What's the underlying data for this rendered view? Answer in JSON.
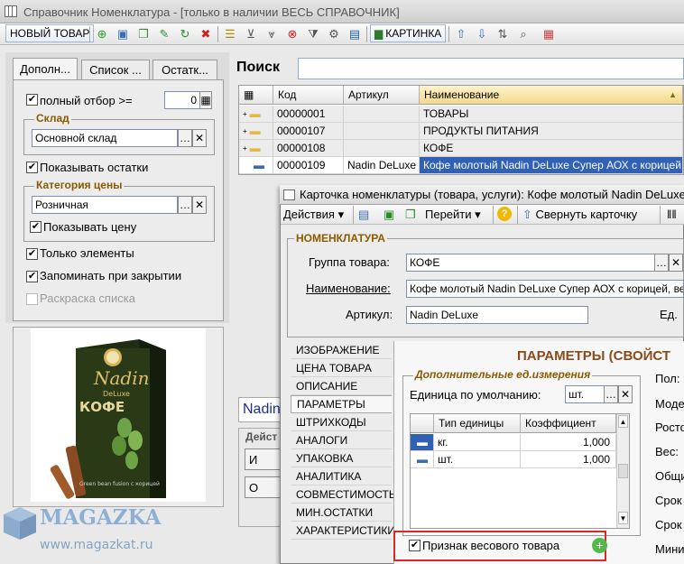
{
  "window": {
    "title": "Справочник Номенклатура - [только в наличии ВЕСЬ СПРАВОЧНИК]"
  },
  "toolbar": {
    "new_item_label": "НОВЫЙ ТОВАР",
    "picture_label": "КАРТИНКА"
  },
  "left_tabs": [
    "Дополн...",
    "Список ...",
    "Остатк..."
  ],
  "filters": {
    "full_select_label": "полный отбор >=",
    "full_select_value": "0",
    "warehouse_group": "Склад",
    "warehouse_value": "Основной склад",
    "show_stock_label": "Показывать остатки",
    "price_group": "Категория цены",
    "price_value": "Розничная",
    "show_price_label": "Показывать цену",
    "only_elements_label": "Только элементы",
    "remember_label": "Запоминать при закрытии",
    "coloring_label": "Раскраска списка"
  },
  "product_image": {
    "brand": "Nadin",
    "sub": "DeLuxe",
    "name": "КОФЕ",
    "caption": "Green bean fusion с корицей"
  },
  "search": {
    "label": "Поиск",
    "value": ""
  },
  "grid": {
    "columns": [
      "Код",
      "Артикул",
      "Наименование"
    ],
    "rows": [
      {
        "code": "00000001",
        "article": "",
        "name": "ТОВАРЫ"
      },
      {
        "code": "00000107",
        "article": "",
        "name": "ПРОДУКТЫ ПИТАНИЯ"
      },
      {
        "code": "00000108",
        "article": "",
        "name": "КОФЕ"
      },
      {
        "code": "00000109",
        "article": "Nadin DeLuxe",
        "name": "Кофе молотый Nadin DeLuxe Супер АОХ с корицей, в..."
      }
    ]
  },
  "under": {
    "strip_text": "Nadin",
    "group_label": "Дейст",
    "btn1": "И",
    "btn2": "О"
  },
  "card": {
    "title": "Карточка номенклатуры (товара, услуги): Кофе молотый Nadin DeLuxe",
    "actions_label": "Действия",
    "goto_label": "Перейти",
    "collapse_label": "Свернуть карточку",
    "section_title": "НОМЕНКЛАТУРА",
    "group_label": "Группа товара:",
    "group_value": "КОФЕ",
    "name_label": "Наименование:",
    "name_value": "Кофе молотый Nadin DeLuxe Супер АОХ с корицей, весовой",
    "article_label": "Артикул:",
    "article_value": "Nadin DeLuxe",
    "ed_label": "Ед.",
    "side_tabs": [
      "ИЗОБРАЖЕНИЕ",
      "ЦЕНА ТОВАРА",
      "ОПИСАНИЕ",
      "ПАРАМЕТРЫ",
      "ШТРИХКОДЫ",
      "АНАЛОГИ",
      "УПАКОВКА",
      "АНАЛИТИКА",
      "СОВМЕСТИМОСТЬ",
      "МИН.ОСТАТКИ",
      "ХАРАКТЕРИСТИКИ"
    ],
    "params_title": "ПАРАМЕТРЫ (СВОЙСТ",
    "units_group": "Дополнительные ед.измерения",
    "default_unit_label": "Единица по умолчанию:",
    "default_unit_value": "шт.",
    "unit_columns": [
      "Тип единицы",
      "Коэффициент"
    ],
    "units": [
      {
        "type": "кг.",
        "coef": "1,000"
      },
      {
        "type": "шт.",
        "coef": "1,000"
      }
    ],
    "weight_checkbox_label": "Признак весового товара",
    "right_labels": [
      "Пол:",
      "Моде",
      "Росто",
      "Вес:",
      "Общи",
      "Срок",
      "Срок",
      "Мини"
    ]
  },
  "watermark": {
    "name": "MAGAZKA",
    "url": "www.magazkat.ru"
  }
}
